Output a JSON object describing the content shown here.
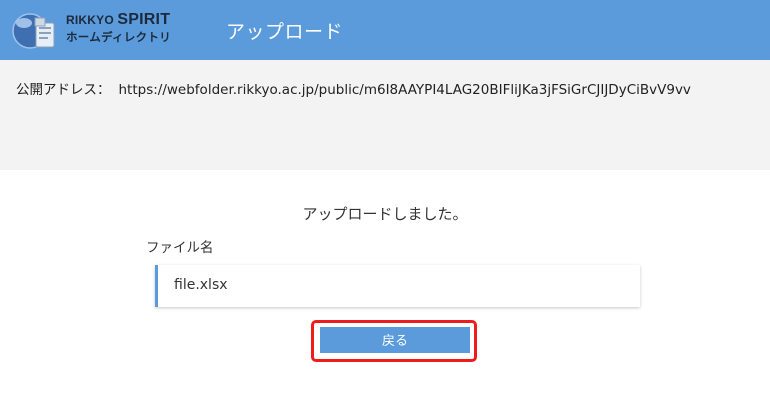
{
  "header": {
    "logo_line1_a": "RIKKYO ",
    "logo_line1_b": "SPIRIT",
    "logo_line2": "ホームディレクトリ",
    "title": "アップロード",
    "bg_color": "#5b9bdc"
  },
  "address": {
    "label": "公開アドレス：",
    "url": "https://webfolder.rikkyo.ac.jp/public/m6I8AAYPI4LAG20BIFliJKa3jFSiGrCJIJDyCiBvV9vv"
  },
  "main": {
    "message": "アップロードしました。",
    "file_label": "ファイル名",
    "file_name": "file.xlsx",
    "back_label": "戻る",
    "accent_color": "#5b9bdc",
    "highlight_color": "#ee1c1c"
  }
}
